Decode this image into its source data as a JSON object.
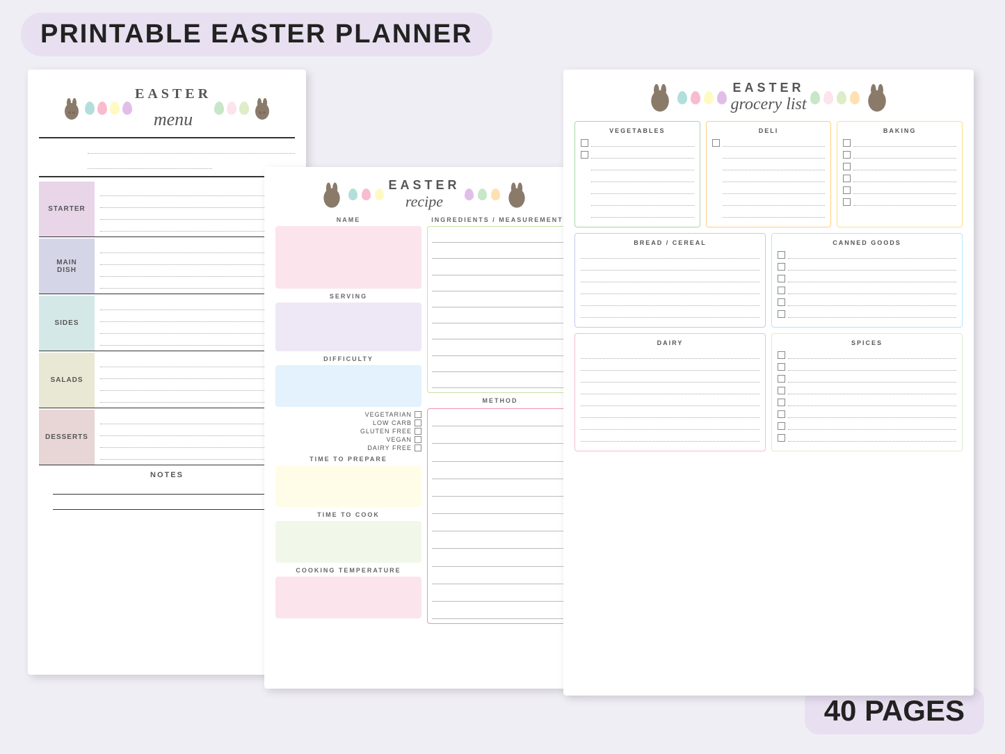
{
  "title": "PRINTABLE EASTER PLANNER",
  "pages_badge": "40 PAGES",
  "background_color": "#f0eef5",
  "menu_card": {
    "easter_label": "EASTER",
    "menu_script": "menu",
    "sections": [
      {
        "label": "STARTER",
        "color_class": "starter-bg",
        "lines": 4
      },
      {
        "label": "MAIN\nDISH",
        "color_class": "maindish-bg",
        "lines": 4
      },
      {
        "label": "SIDES",
        "color_class": "sides-bg",
        "lines": 4
      },
      {
        "label": "SALADS",
        "color_class": "salads-bg",
        "lines": 4
      },
      {
        "label": "DESSERTS",
        "color_class": "desserts-bg",
        "lines": 4
      }
    ],
    "notes_label": "NOTES"
  },
  "recipe_card": {
    "easter_label": "EASTER",
    "recipe_script": "recipe",
    "fields": {
      "name": "NAME",
      "serving": "SERVING",
      "difficulty": "DIFFICULTY",
      "ingredients": "INGREDIENTS / MEASUREMENTS",
      "vegetarian": "VEGETARIAN",
      "low_carb": "LOW CARB",
      "gluten_free": "GLUTEN FREE",
      "vegan": "VEGAN",
      "dairy_free": "DAIRY FREE",
      "time_prepare": "TIME TO PREPARE",
      "time_cook": "TIME TO COOK",
      "cooking_temp": "COOKING TEMPERATURE",
      "method": "METHOD"
    }
  },
  "grocery_card": {
    "easter_label": "EASTER",
    "grocery_script": "grocery list",
    "sections": {
      "vegetables": "VEGETABLES",
      "deli": "DELI",
      "baking": "BAKING",
      "bread_cereal": "BREAD / CEREAL",
      "canned_goods": "CANNED GOODS",
      "dairy": "DAIRY",
      "spices": "SPICES"
    }
  },
  "eggs": [
    {
      "color": "#b2dfdb"
    },
    {
      "color": "#f8bbd0"
    },
    {
      "color": "#fff9c4"
    },
    {
      "color": "#e1bee7"
    },
    {
      "color": "#c8e6c9"
    },
    {
      "color": "#fce4ec"
    },
    {
      "color": "#dcedc8"
    },
    {
      "color": "#ffe0b2"
    }
  ]
}
